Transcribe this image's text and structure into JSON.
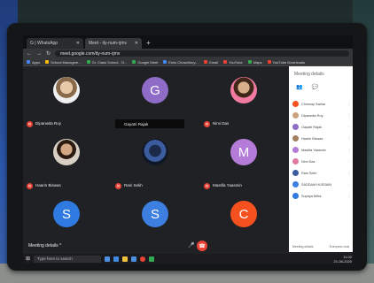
{
  "browser": {
    "tabs": [
      {
        "label": "G | WhatsApp"
      },
      {
        "label": "Meet - ity-num-rjmv"
      }
    ],
    "url": "meet.google.com/ity-num-rjmv",
    "bookmarks": [
      "Apps",
      "School Managem...",
      "Gr. Class School - G...",
      "Google Meet",
      "Emis Chowdhury...",
      "Gmail",
      "YouTube",
      "Maps",
      "YouTube Downloads"
    ]
  },
  "participants": [
    {
      "name": "Dipanwita Roy",
      "initial": "",
      "color": "",
      "kind": "photo"
    },
    {
      "name": "Gayatri Rajak",
      "initial": "G",
      "color": "#8e6cc8",
      "kind": "letter"
    },
    {
      "name": "Nirvi Das",
      "initial": "",
      "color": "",
      "kind": "photo2"
    },
    {
      "name": "Haarin Biswas",
      "initial": "",
      "color": "",
      "kind": "photo3"
    },
    {
      "name": "Rani Sekh",
      "initial": "",
      "color": "",
      "kind": "photo4"
    },
    {
      "name": "Mastifa Yaasmin",
      "initial": "M",
      "color": "#b57bd8",
      "kind": "letter"
    },
    {
      "name": "Supriya Mitra",
      "initial": "S",
      "color": "#2f7ae0",
      "kind": "letter"
    },
    {
      "name": "SADDAM HUSSAIN",
      "initial": "S",
      "color": "#3d7fe0",
      "kind": "letter"
    },
    {
      "name": "Chinmay Sarkar",
      "initial": "C",
      "color": "#f4511e",
      "kind": "letter"
    }
  ],
  "panel": {
    "title": "Meeting details",
    "people": [
      "Chinmay Sarkar",
      "Dipanwita Roy",
      "Gayatri Rajak",
      "Haarin Biswas",
      "Mastifa Yaasmin",
      "Nirvi Das",
      "Rani Sekh",
      "SADDAM HUSSAIN",
      "Supriya Mitra"
    ],
    "footer_left": "Meeting details",
    "footer_right": "Everyone chat"
  },
  "controls": {
    "meeting_details": "Meeting details ^"
  },
  "taskbar": {
    "search_placeholder": "Type here to search",
    "time": "11:02",
    "date": "21-08-2020"
  }
}
